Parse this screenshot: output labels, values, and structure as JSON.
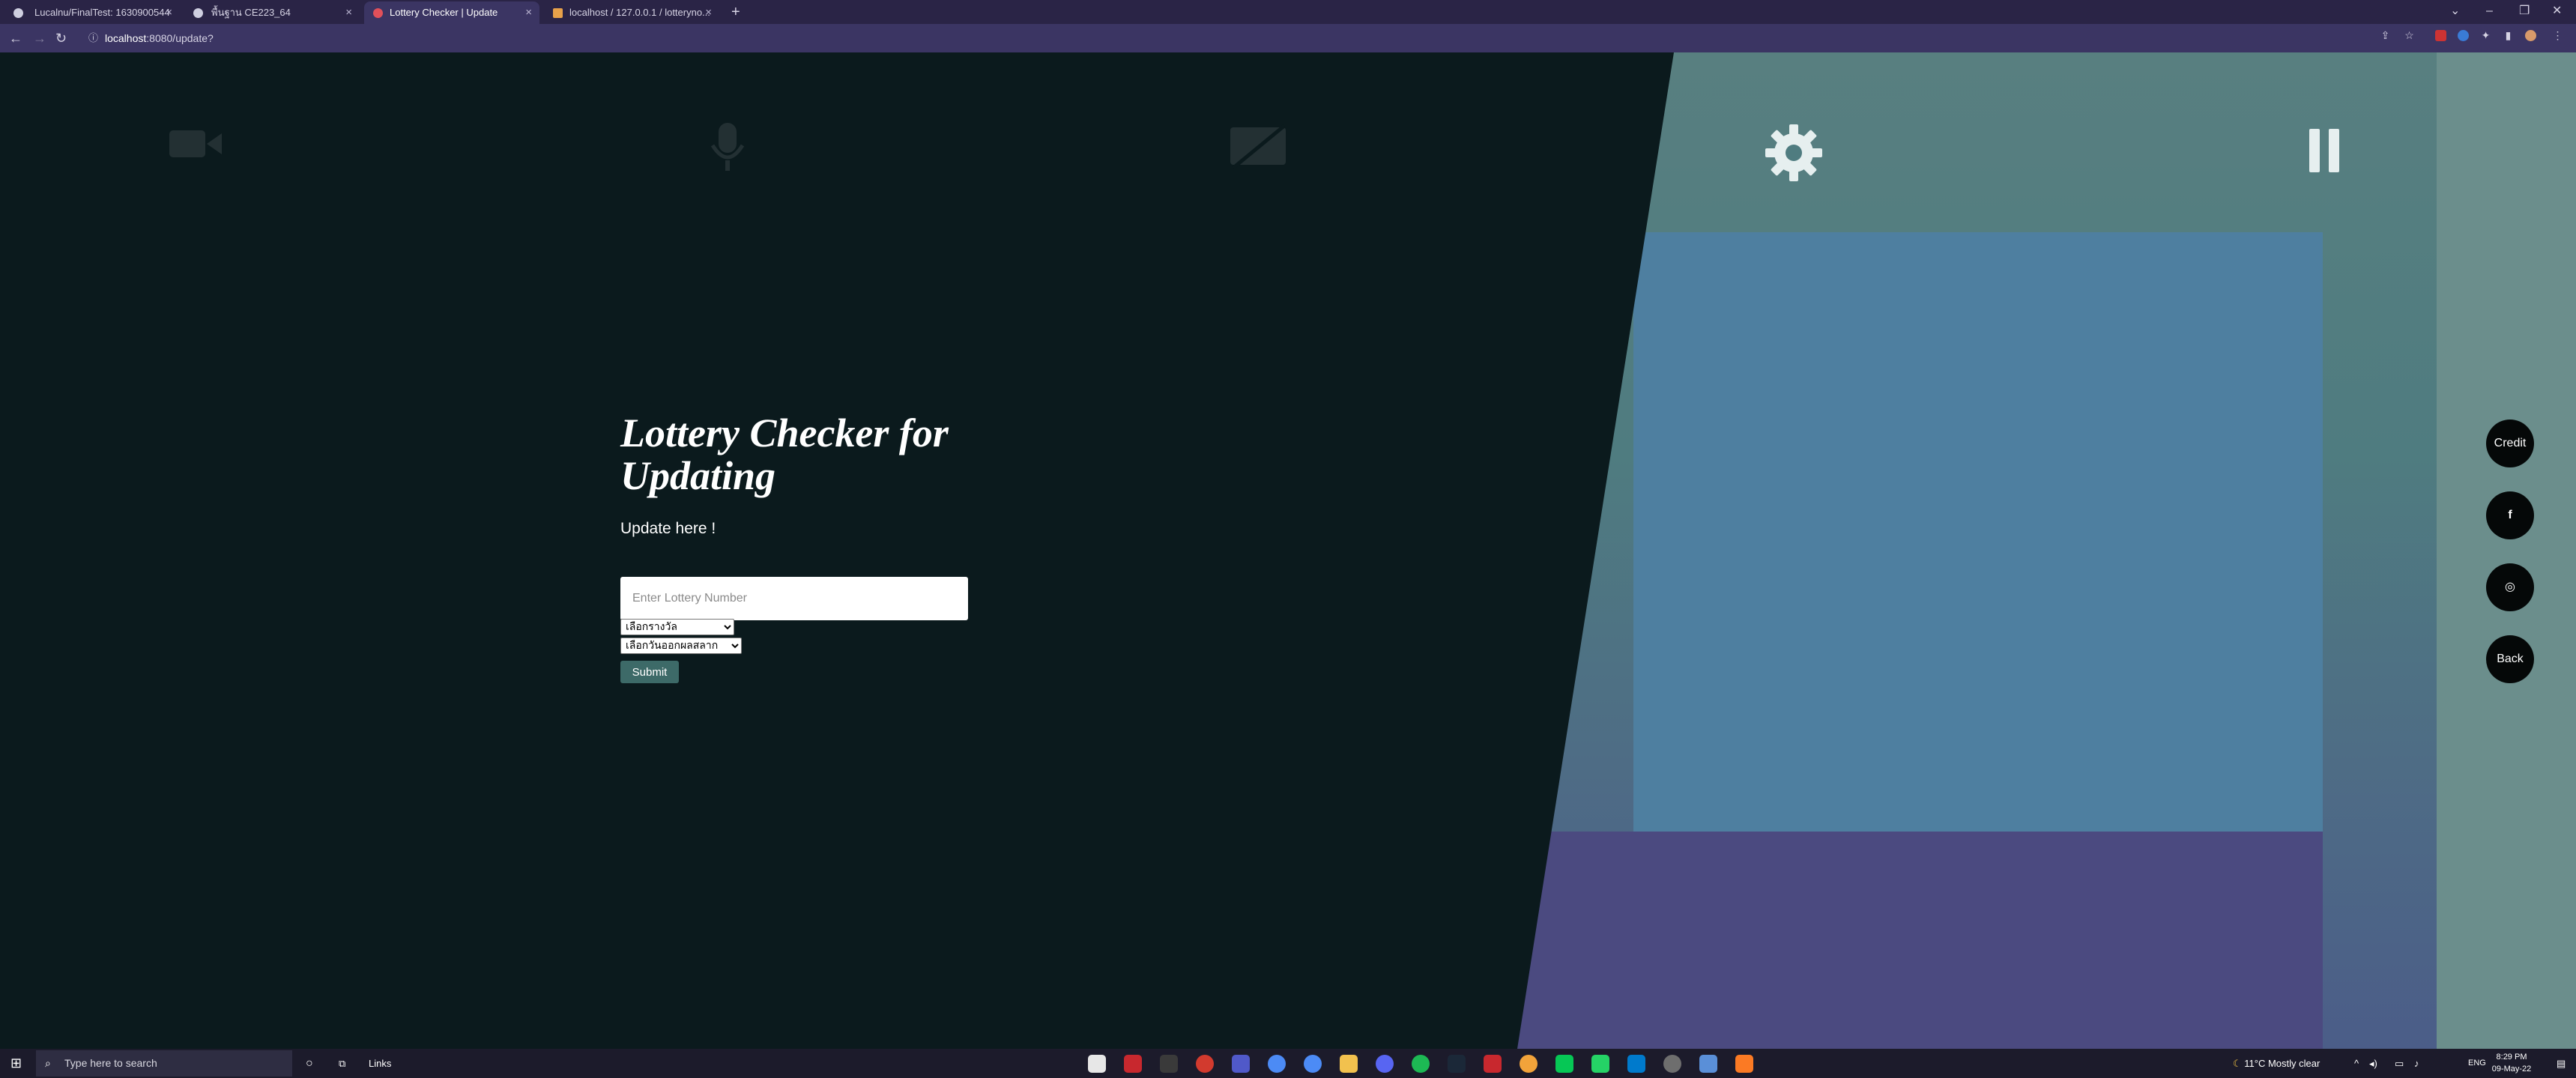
{
  "browser": {
    "tabs": [
      {
        "title": "Lucalnu/FinalTest: 1630900544",
        "active": false
      },
      {
        "title": "พื้นฐาน CE223_64",
        "active": false
      },
      {
        "title": "Lottery Checker | Update",
        "active": true
      },
      {
        "title": "localhost / 127.0.0.1 / lotteryno...",
        "active": false
      }
    ],
    "new_tab_icon": "plus-icon",
    "url_host": "localhost",
    "url_path": ":8080/update?"
  },
  "page": {
    "title": "Lottery Checker for Updating",
    "subtitle": "Update here !",
    "lottery_input": {
      "placeholder": "Enter Lottery Number",
      "value": ""
    },
    "prize_select": {
      "selected": "เลือกรางวัล"
    },
    "date_select": {
      "selected": "เลือกวันออกผลสลาก"
    },
    "submit_label": "Submit",
    "side_buttons": [
      {
        "label": "Credit"
      },
      {
        "label": "f",
        "icon": "facebook-icon"
      },
      {
        "label": "◎",
        "icon": "instagram-icon"
      },
      {
        "label": "Back"
      }
    ],
    "overlay_icons": [
      "camera-icon",
      "microphone-icon",
      "screen-share-off-icon",
      "settings-icon",
      "pause-icon"
    ]
  },
  "taskbar": {
    "search_placeholder": "Type here to search",
    "links_label": "Links",
    "weather": "11°C  Mostly clear",
    "language": "ENG",
    "time": "8:29 PM",
    "date": "09-May-22"
  }
}
